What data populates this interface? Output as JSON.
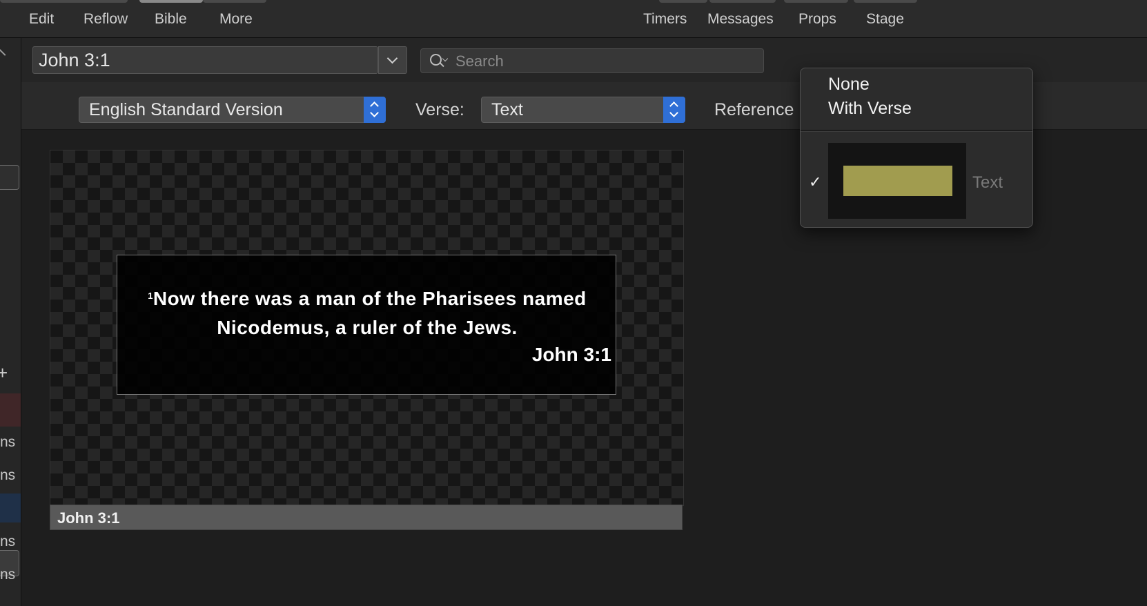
{
  "menubar": {
    "items": [
      "Edit",
      "Reflow",
      "Bible",
      "More"
    ]
  },
  "right_menubar": {
    "items": [
      "Timers",
      "Messages",
      "Props",
      "Stage"
    ]
  },
  "sidebar": {
    "fragments": [
      "ns",
      "ns",
      "ns",
      "ns"
    ]
  },
  "reference_field": {
    "value": "John 3:1"
  },
  "search": {
    "placeholder": "Search"
  },
  "translation": {
    "selected": "English Standard Version"
  },
  "verse_option": {
    "label": "Verse:",
    "selected": "Text"
  },
  "reference_option": {
    "label": "Reference"
  },
  "preview": {
    "verse_number": "1",
    "verse_text": "Now there was a man of the Pharisees named Nicodemus, a ruler of the Jews.",
    "reference": "John 3:1",
    "caption": "John 3:1"
  },
  "reference_menu": {
    "items": [
      "None",
      "With Verse"
    ],
    "checked_index": 1,
    "check_mark": "✓",
    "style_label": "Text",
    "style_swatch_color": "#a19c4f"
  },
  "colors": {
    "accent": "#2f6fd6",
    "background": "#1e1e1e",
    "toolbar": "#2b2b2b"
  }
}
